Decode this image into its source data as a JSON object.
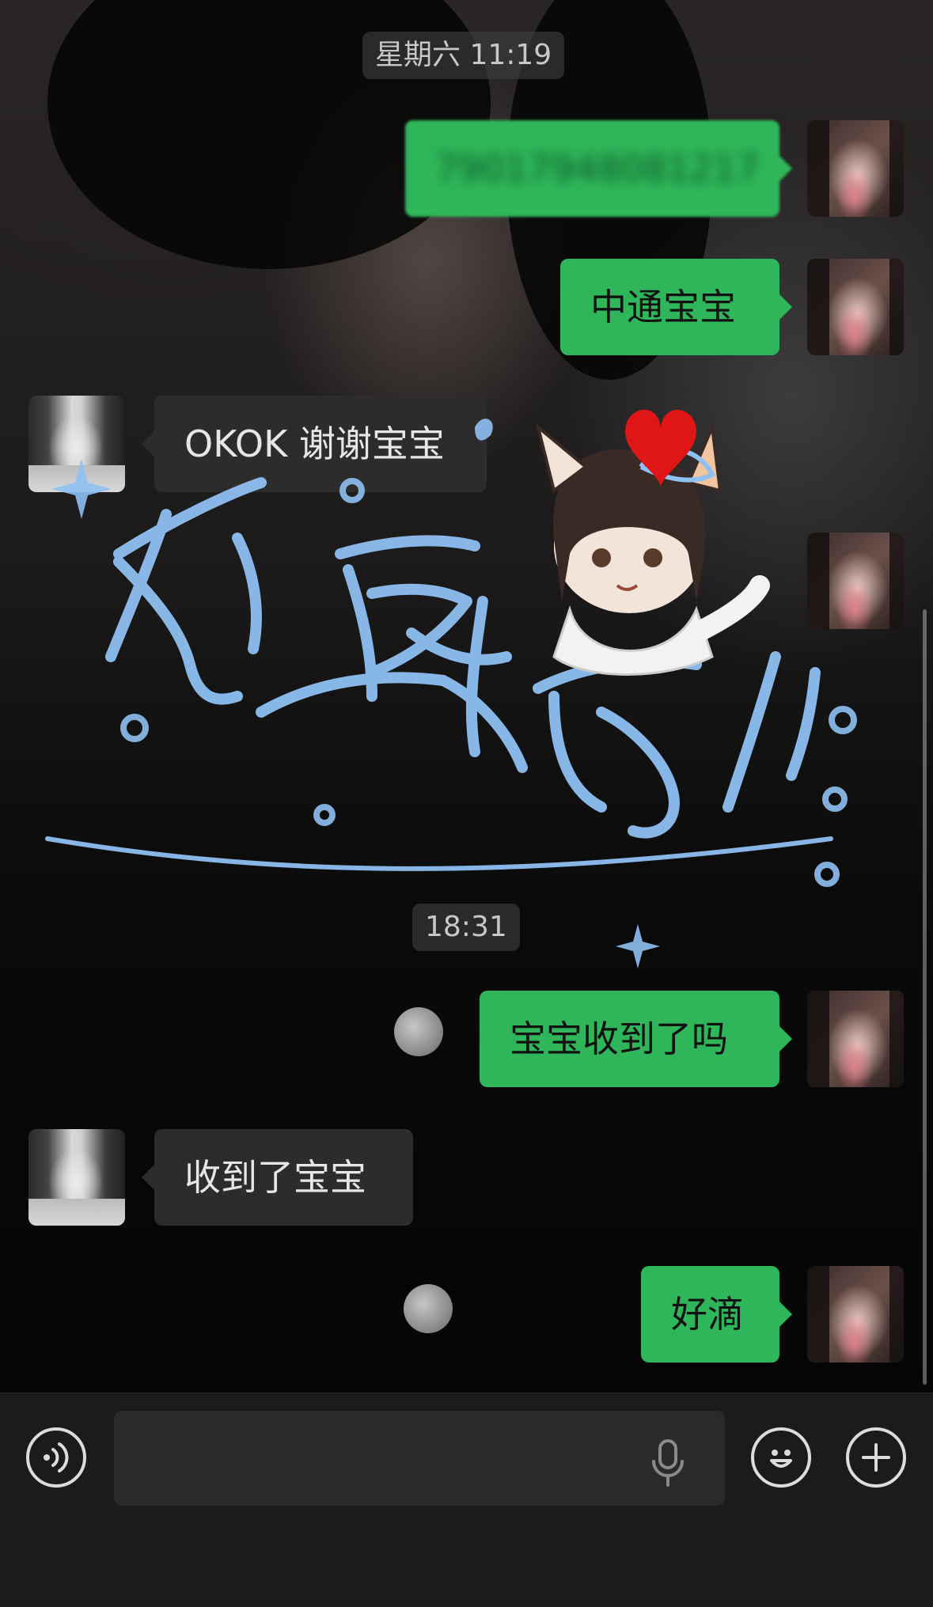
{
  "timestamps": [
    "星期六 11:19",
    "18:31"
  ],
  "messages": {
    "m1": {
      "sender": "self",
      "text": "79017948081217",
      "blurred": true
    },
    "m2": {
      "sender": "self",
      "text": "中通宝宝"
    },
    "m3": {
      "sender": "other",
      "text": "OKOK 谢谢宝宝"
    },
    "m4": {
      "sender": "self",
      "text": ""
    },
    "m5": {
      "sender": "self",
      "text": "宝宝收到了吗"
    },
    "m6": {
      "sender": "other",
      "text": "收到了宝宝"
    },
    "m7": {
      "sender": "self",
      "text": "好滴"
    }
  },
  "colors": {
    "self_bubble": "#2fb65a",
    "other_bubble": "#2c2c2c",
    "sticker_text": "#8ec0f2",
    "heart": "#e01515"
  },
  "icons": {
    "voice": "voice-toggle-icon",
    "mic": "microphone-icon",
    "emoji": "emoji-icon",
    "more": "plus-icon"
  }
}
